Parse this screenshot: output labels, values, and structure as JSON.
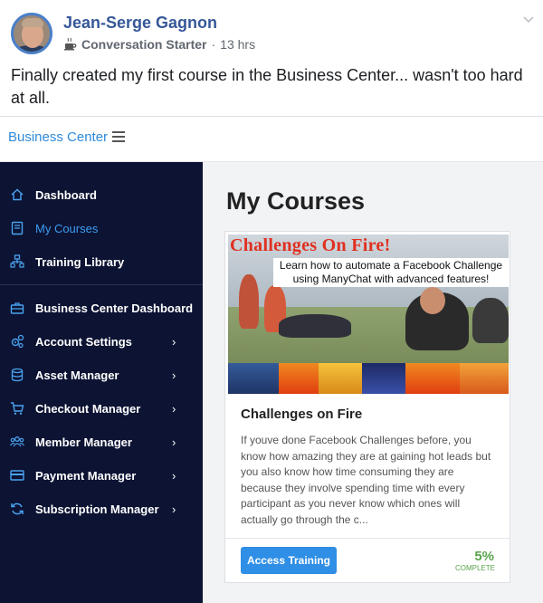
{
  "post": {
    "author": "Jean-Serge Gagnon",
    "badge": "Conversation Starter",
    "separator": "·",
    "time": "13 hrs",
    "text": "Finally created my first course in the Business Center... wasn't too hard at all."
  },
  "app": {
    "brand": "Business Center",
    "sidebar": {
      "items": [
        {
          "label": "Dashboard",
          "icon": "home-icon",
          "arrow": ""
        },
        {
          "label": "My Courses",
          "icon": "book-icon",
          "arrow": ""
        },
        {
          "label": "Training Library",
          "icon": "hierarchy-icon",
          "arrow": ""
        },
        {
          "label": "Business Center Dashboard",
          "icon": "briefcase-icon",
          "arrow": ""
        },
        {
          "label": "Account Settings",
          "icon": "gears-icon",
          "arrow": "›"
        },
        {
          "label": "Asset Manager",
          "icon": "database-icon",
          "arrow": "›"
        },
        {
          "label": "Checkout Manager",
          "icon": "cart-icon",
          "arrow": "›"
        },
        {
          "label": "Member Manager",
          "icon": "users-icon",
          "arrow": "›"
        },
        {
          "label": "Payment Manager",
          "icon": "credit-card-icon",
          "arrow": "›"
        },
        {
          "label": "Subscription Manager",
          "icon": "sync-icon",
          "arrow": "›"
        }
      ],
      "active_index": 1
    },
    "main": {
      "title": "My Courses",
      "course": {
        "thumb_headline": "Challenges On Fire!",
        "thumb_subtitle": "Learn how to automate a Facebook Challenge using ManyChat with advanced features!",
        "name": "Challenges on Fire",
        "description": "If youve done Facebook Challenges before, you know how amazing they are at gaining hot leads but you also know how time consuming they are because they involve spending time with every participant as you never know which ones will actually go through the c...",
        "button_label": "Access Training",
        "progress_text": "5%",
        "progress_value": 5,
        "progress_label": "COMPLETE"
      }
    }
  },
  "colors": {
    "author_blue": "#365899",
    "sidebar_bg": "#0c1333",
    "active_link": "#3d9df2",
    "button_blue": "#2f8ee5",
    "progress_green": "#5aa44c"
  }
}
